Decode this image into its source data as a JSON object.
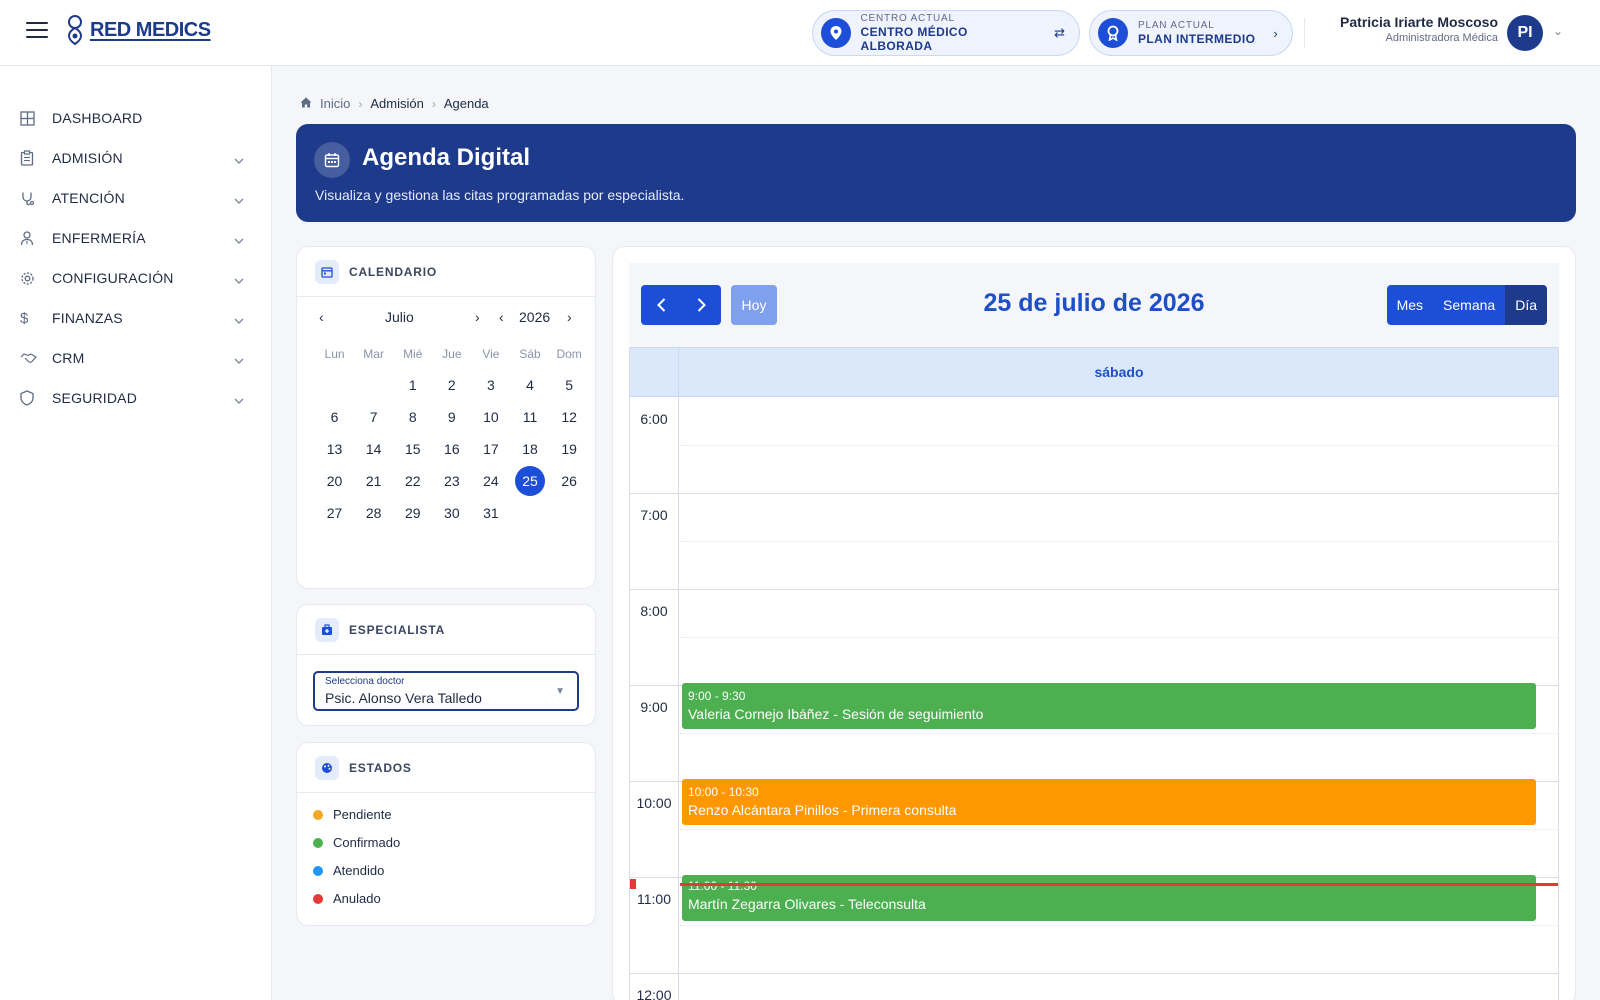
{
  "header": {
    "brand": "RED MEDICS",
    "center": {
      "caption": "CENTRO ACTUAL",
      "value": "CENTRO MÉDICO ALBORADA"
    },
    "plan": {
      "caption": "PLAN ACTUAL",
      "value": "PLAN INTERMEDIO"
    },
    "user": {
      "name": "Patricia Iriarte Moscoso",
      "role": "Administradora Médica",
      "initials": "PI"
    }
  },
  "sidebar": {
    "items": [
      {
        "label": "DASHBOARD",
        "icon": "grid-icon"
      },
      {
        "label": "ADMISIÓN",
        "icon": "clipboard-icon"
      },
      {
        "label": "ATENCIÓN",
        "icon": "stethoscope-icon"
      },
      {
        "label": "ENFERMERÍA",
        "icon": "nurse-icon"
      },
      {
        "label": "CONFIGURACIÓN",
        "icon": "gear-icon"
      },
      {
        "label": "FINANZAS",
        "icon": "dollar-icon"
      },
      {
        "label": "CRM",
        "icon": "handshake-icon"
      },
      {
        "label": "SEGURIDAD",
        "icon": "shield-icon"
      }
    ]
  },
  "breadcrumb": {
    "home": "Inicio",
    "section": "Admisión",
    "current": "Agenda"
  },
  "banner": {
    "title": "Agenda Digital",
    "subtitle": "Visualiza y gestiona las citas programadas por especialista."
  },
  "calendar": {
    "title": "CALENDARIO",
    "month": "Julio",
    "year": "2026",
    "weekdays": [
      "Lun",
      "Mar",
      "Mié",
      "Jue",
      "Vie",
      "Sáb",
      "Dom"
    ],
    "weeks": [
      [
        "",
        "",
        "1",
        "2",
        "3",
        "4",
        "5"
      ],
      [
        "6",
        "7",
        "8",
        "9",
        "10",
        "11",
        "12"
      ],
      [
        "13",
        "14",
        "15",
        "16",
        "17",
        "18",
        "19"
      ],
      [
        "20",
        "21",
        "22",
        "23",
        "24",
        "25",
        "26"
      ],
      [
        "27",
        "28",
        "29",
        "30",
        "31",
        "",
        ""
      ]
    ],
    "selected": "25"
  },
  "specialist": {
    "title": "ESPECIALISTA",
    "label": "Selecciona doctor",
    "value": "Psic. Alonso Vera Talledo"
  },
  "states": {
    "title": "ESTADOS",
    "items": [
      {
        "label": "Pendiente",
        "color": "#f5a623"
      },
      {
        "label": "Confirmado",
        "color": "#4caf50"
      },
      {
        "label": "Atendido",
        "color": "#2196f3"
      },
      {
        "label": "Anulado",
        "color": "#e53935"
      }
    ]
  },
  "agenda": {
    "today": "Hoy",
    "date_title": "25 de julio de 2026",
    "views": [
      "Mes",
      "Semana",
      "Día"
    ],
    "day_name": "sábado",
    "hours": [
      "6:00",
      "7:00",
      "8:00",
      "9:00",
      "10:00",
      "11:00",
      "12:00"
    ],
    "events": [
      {
        "time": "9:00 - 9:30",
        "desc": "Valeria Cornejo Ibáñez - Sesión de seguimiento",
        "status": "Confirmado",
        "color": "#4caf50"
      },
      {
        "time": "10:00 - 10:30",
        "desc": "Renzo Alcántara Pinillos - Primera consulta",
        "status": "Pendiente",
        "color": "#ff9800"
      },
      {
        "time": "11:00 - 11:30",
        "desc": "Martín Zegarra Olivares - Teleconsulta",
        "status": "Confirmado",
        "color": "#4caf50"
      }
    ]
  },
  "colors": {
    "primary": "#1d4ed8",
    "navy": "#1e3a8a",
    "now_line": "#e53935"
  }
}
